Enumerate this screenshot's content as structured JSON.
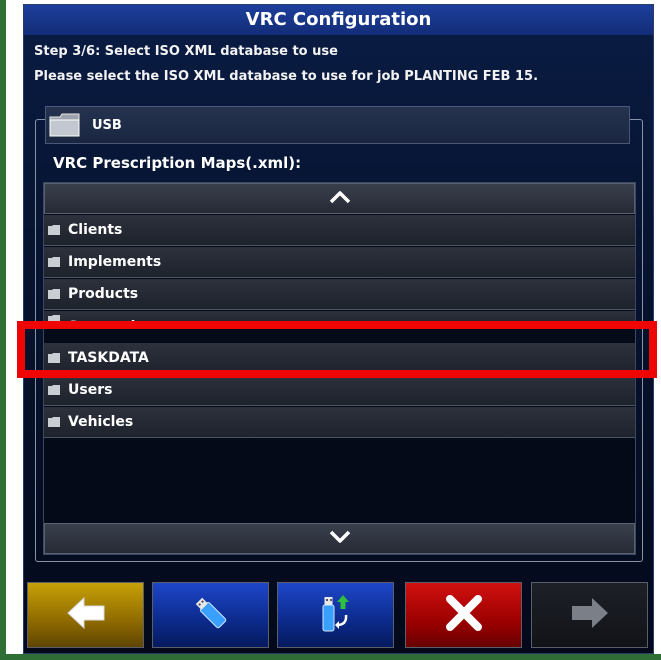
{
  "window": {
    "title": "VRC Configuration"
  },
  "instructions": {
    "step": "Step 3/6: Select ISO XML database to use",
    "prompt": "Please select the ISO XML database to use for job PLANTING FEB 15."
  },
  "source": {
    "label": "USB",
    "icon": "folder-icon"
  },
  "list": {
    "heading": "VRC Prescription Maps(.xml):",
    "items": [
      {
        "label": "Clients",
        "icon": "folder-icon"
      },
      {
        "label": "Implements",
        "icon": "folder-icon"
      },
      {
        "label": "Products",
        "icon": "folder-icon"
      },
      {
        "label": "Screenshots",
        "icon": "folder-icon"
      },
      {
        "label": "TASKDATA",
        "icon": "folder-icon",
        "highlighted": true
      },
      {
        "label": "Users",
        "icon": "folder-icon"
      },
      {
        "label": "Vehicles",
        "icon": "folder-icon"
      }
    ],
    "scroll_up_icon": "chevron-up-icon",
    "scroll_down_icon": "chevron-down-icon"
  },
  "toolbar": [
    {
      "name": "back",
      "icon": "arrow-left-icon",
      "color": "#c7a108"
    },
    {
      "name": "usb",
      "icon": "usb-drive-icon",
      "color": "#1e46c9"
    },
    {
      "name": "export",
      "icon": "usb-export-icon",
      "color": "#1e46c9"
    },
    {
      "name": "cancel",
      "icon": "close-icon",
      "color": "#d21010"
    },
    {
      "name": "next",
      "icon": "arrow-right-icon",
      "color": "#1d2027",
      "disabled": true
    }
  ],
  "highlight_color": "#f00505"
}
